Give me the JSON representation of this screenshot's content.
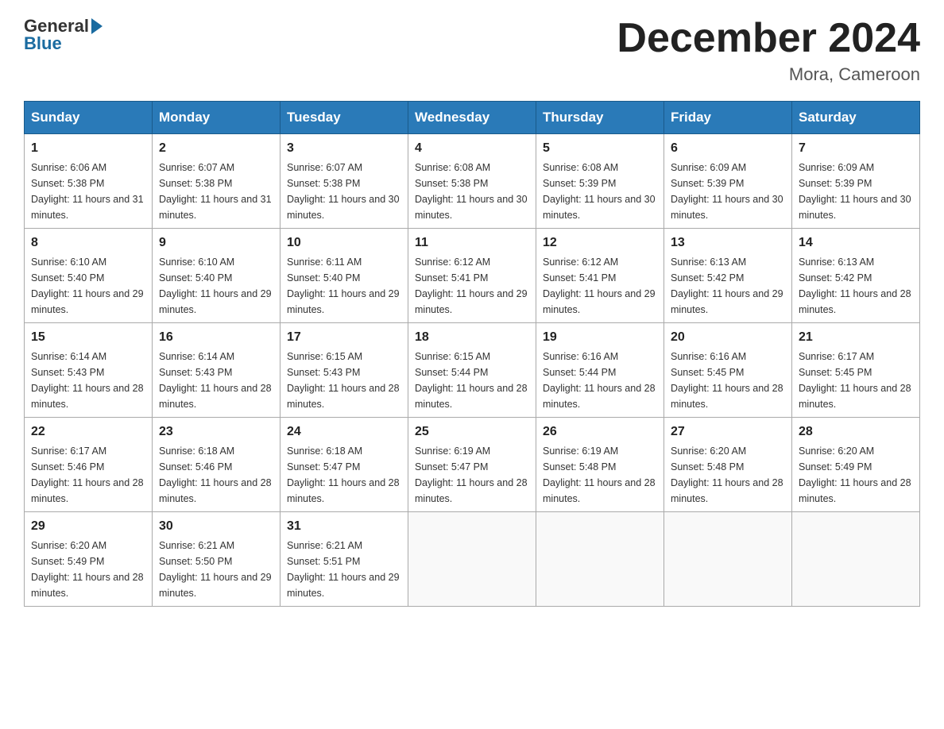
{
  "header": {
    "logo_general": "General",
    "logo_blue": "Blue",
    "title": "December 2024",
    "location": "Mora, Cameroon"
  },
  "calendar": {
    "days_of_week": [
      "Sunday",
      "Monday",
      "Tuesday",
      "Wednesday",
      "Thursday",
      "Friday",
      "Saturday"
    ],
    "weeks": [
      [
        {
          "day": "1",
          "sunrise": "6:06 AM",
          "sunset": "5:38 PM",
          "daylight": "11 hours and 31 minutes."
        },
        {
          "day": "2",
          "sunrise": "6:07 AM",
          "sunset": "5:38 PM",
          "daylight": "11 hours and 31 minutes."
        },
        {
          "day": "3",
          "sunrise": "6:07 AM",
          "sunset": "5:38 PM",
          "daylight": "11 hours and 30 minutes."
        },
        {
          "day": "4",
          "sunrise": "6:08 AM",
          "sunset": "5:38 PM",
          "daylight": "11 hours and 30 minutes."
        },
        {
          "day": "5",
          "sunrise": "6:08 AM",
          "sunset": "5:39 PM",
          "daylight": "11 hours and 30 minutes."
        },
        {
          "day": "6",
          "sunrise": "6:09 AM",
          "sunset": "5:39 PM",
          "daylight": "11 hours and 30 minutes."
        },
        {
          "day": "7",
          "sunrise": "6:09 AM",
          "sunset": "5:39 PM",
          "daylight": "11 hours and 30 minutes."
        }
      ],
      [
        {
          "day": "8",
          "sunrise": "6:10 AM",
          "sunset": "5:40 PM",
          "daylight": "11 hours and 29 minutes."
        },
        {
          "day": "9",
          "sunrise": "6:10 AM",
          "sunset": "5:40 PM",
          "daylight": "11 hours and 29 minutes."
        },
        {
          "day": "10",
          "sunrise": "6:11 AM",
          "sunset": "5:40 PM",
          "daylight": "11 hours and 29 minutes."
        },
        {
          "day": "11",
          "sunrise": "6:12 AM",
          "sunset": "5:41 PM",
          "daylight": "11 hours and 29 minutes."
        },
        {
          "day": "12",
          "sunrise": "6:12 AM",
          "sunset": "5:41 PM",
          "daylight": "11 hours and 29 minutes."
        },
        {
          "day": "13",
          "sunrise": "6:13 AM",
          "sunset": "5:42 PM",
          "daylight": "11 hours and 29 minutes."
        },
        {
          "day": "14",
          "sunrise": "6:13 AM",
          "sunset": "5:42 PM",
          "daylight": "11 hours and 28 minutes."
        }
      ],
      [
        {
          "day": "15",
          "sunrise": "6:14 AM",
          "sunset": "5:43 PM",
          "daylight": "11 hours and 28 minutes."
        },
        {
          "day": "16",
          "sunrise": "6:14 AM",
          "sunset": "5:43 PM",
          "daylight": "11 hours and 28 minutes."
        },
        {
          "day": "17",
          "sunrise": "6:15 AM",
          "sunset": "5:43 PM",
          "daylight": "11 hours and 28 minutes."
        },
        {
          "day": "18",
          "sunrise": "6:15 AM",
          "sunset": "5:44 PM",
          "daylight": "11 hours and 28 minutes."
        },
        {
          "day": "19",
          "sunrise": "6:16 AM",
          "sunset": "5:44 PM",
          "daylight": "11 hours and 28 minutes."
        },
        {
          "day": "20",
          "sunrise": "6:16 AM",
          "sunset": "5:45 PM",
          "daylight": "11 hours and 28 minutes."
        },
        {
          "day": "21",
          "sunrise": "6:17 AM",
          "sunset": "5:45 PM",
          "daylight": "11 hours and 28 minutes."
        }
      ],
      [
        {
          "day": "22",
          "sunrise": "6:17 AM",
          "sunset": "5:46 PM",
          "daylight": "11 hours and 28 minutes."
        },
        {
          "day": "23",
          "sunrise": "6:18 AM",
          "sunset": "5:46 PM",
          "daylight": "11 hours and 28 minutes."
        },
        {
          "day": "24",
          "sunrise": "6:18 AM",
          "sunset": "5:47 PM",
          "daylight": "11 hours and 28 minutes."
        },
        {
          "day": "25",
          "sunrise": "6:19 AM",
          "sunset": "5:47 PM",
          "daylight": "11 hours and 28 minutes."
        },
        {
          "day": "26",
          "sunrise": "6:19 AM",
          "sunset": "5:48 PM",
          "daylight": "11 hours and 28 minutes."
        },
        {
          "day": "27",
          "sunrise": "6:20 AM",
          "sunset": "5:48 PM",
          "daylight": "11 hours and 28 minutes."
        },
        {
          "day": "28",
          "sunrise": "6:20 AM",
          "sunset": "5:49 PM",
          "daylight": "11 hours and 28 minutes."
        }
      ],
      [
        {
          "day": "29",
          "sunrise": "6:20 AM",
          "sunset": "5:49 PM",
          "daylight": "11 hours and 28 minutes."
        },
        {
          "day": "30",
          "sunrise": "6:21 AM",
          "sunset": "5:50 PM",
          "daylight": "11 hours and 29 minutes."
        },
        {
          "day": "31",
          "sunrise": "6:21 AM",
          "sunset": "5:51 PM",
          "daylight": "11 hours and 29 minutes."
        },
        null,
        null,
        null,
        null
      ]
    ]
  }
}
